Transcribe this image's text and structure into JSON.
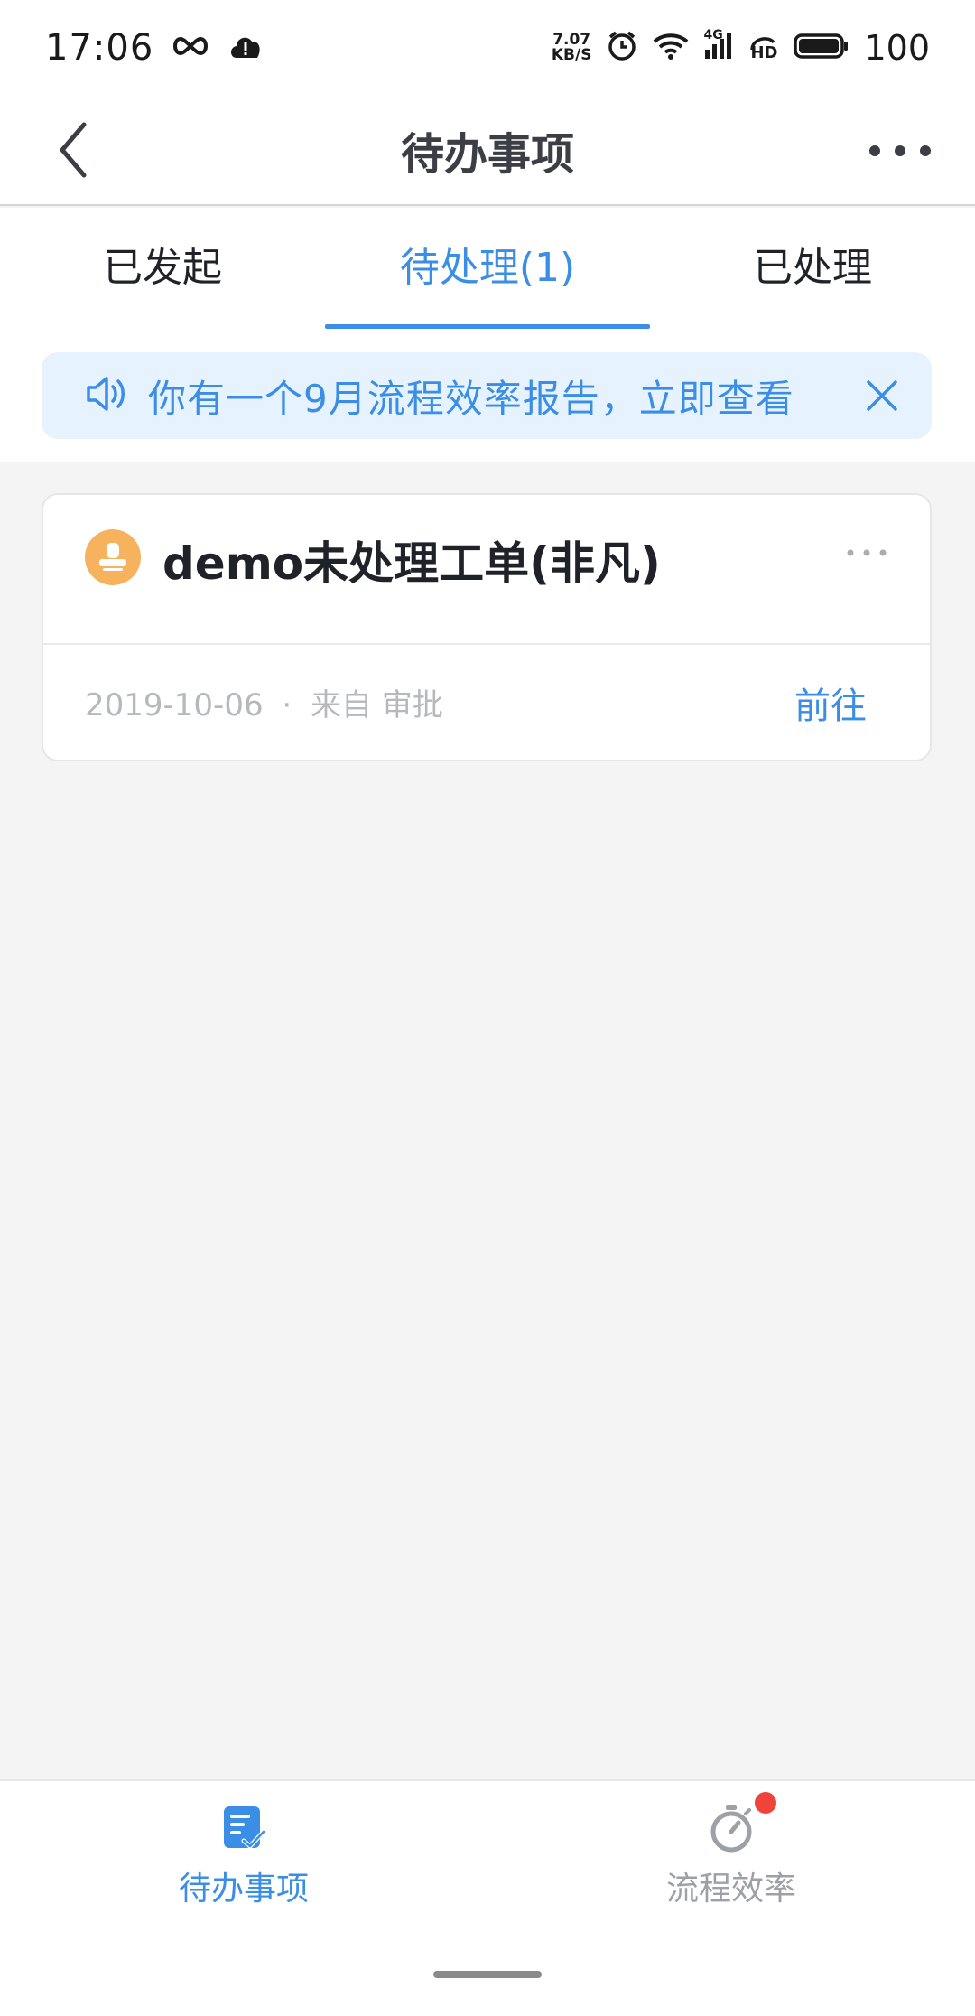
{
  "status_bar": {
    "time": "17:06",
    "net_speed_value": "7.07",
    "net_speed_unit": "KB/S",
    "network_type": "4G",
    "hd_label": "HD",
    "battery": "100"
  },
  "nav": {
    "title": "待办事项"
  },
  "tabs": [
    {
      "label": "已发起",
      "active": false
    },
    {
      "label": "待处理(1)",
      "active": true
    },
    {
      "label": "已处理",
      "active": false
    }
  ],
  "banner": {
    "text": "你有一个9月流程效率报告，立即查看"
  },
  "card": {
    "title": "demo未处理工单(非凡)",
    "date": "2019-10-06",
    "separator": "·",
    "source": "来自 审批",
    "action_label": "前往"
  },
  "bottom_tabs": [
    {
      "label": "待办事项",
      "icon": "todo-doc-icon",
      "active": true
    },
    {
      "label": "流程效率",
      "icon": "stopwatch-icon",
      "active": false,
      "badge": true
    }
  ],
  "colors": {
    "accent": "#3a8ee6",
    "banner_bg": "#e6f2fd",
    "avatar": "#f7b25e",
    "badge": "#f0443b",
    "page_bg": "#f4f4f5"
  }
}
